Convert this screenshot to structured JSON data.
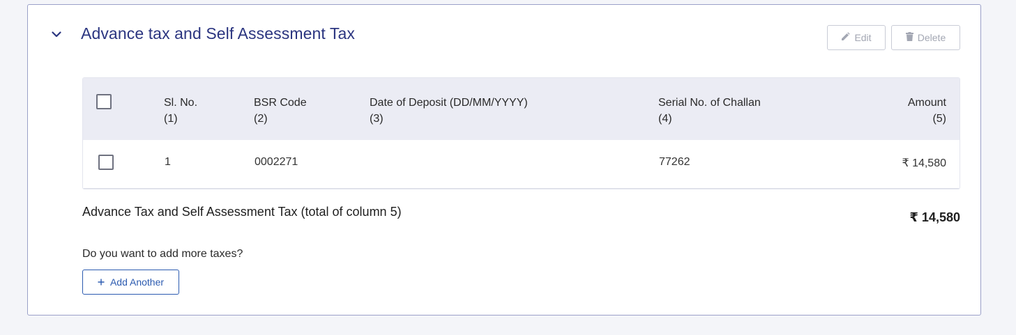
{
  "section": {
    "title": "Advance tax and Self Assessment Tax",
    "toggle_icon": "chevron-down-icon"
  },
  "toolbar": {
    "edit_label": "Edit",
    "edit_icon": "pencil-icon",
    "delete_label": "Delete",
    "delete_icon": "trash-icon",
    "disabled_color": "#a3a7b3"
  },
  "table": {
    "columns": [
      {
        "label": "Sl. No.",
        "sub": "(1)"
      },
      {
        "label": "BSR Code",
        "sub": "(2)"
      },
      {
        "label": "Date of Deposit (DD/MM/YYYY)",
        "sub": "(3)"
      },
      {
        "label": "Serial No. of Challan",
        "sub": "(4)"
      },
      {
        "label": "Amount",
        "sub": "(5)"
      }
    ],
    "rows": [
      {
        "sl_no": "1",
        "bsr_code": "0002271",
        "date_of_deposit": "",
        "serial_no": "77262",
        "amount": "₹ 14,580",
        "checked": false
      }
    ],
    "select_all_checked": false
  },
  "total": {
    "label": "Advance Tax and Self Assessment Tax (total of column 5)",
    "value": "₹ 14,580"
  },
  "add_more": {
    "question": "Do you want to add more taxes?",
    "button_label": "Add Another",
    "button_icon": "plus-icon"
  },
  "colors": {
    "title": "#2b3580",
    "accent": "#2c5bb0",
    "header_bg": "#ebecf4",
    "card_border": "#9aa0c8"
  }
}
